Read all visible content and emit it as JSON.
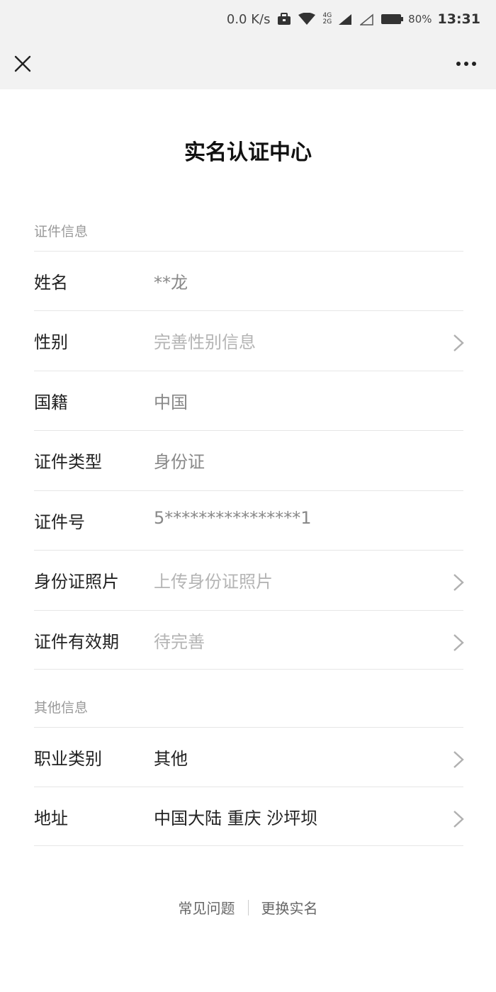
{
  "status_bar": {
    "net_speed": "0.0 K/s",
    "network_type_top": "4G",
    "network_type_bottom": "2G",
    "battery_pct": "80%",
    "time": "13:31"
  },
  "nav": {
    "close_icon": "close-icon",
    "more_icon": "more-icon"
  },
  "page": {
    "title": "实名认证中心"
  },
  "sections": {
    "id_info": {
      "label": "证件信息",
      "rows": [
        {
          "label": "姓名",
          "value": "**龙"
        },
        {
          "label": "性别",
          "value": "完善性别信息"
        },
        {
          "label": "国籍",
          "value": "中国"
        },
        {
          "label": "证件类型",
          "value": "身份证"
        },
        {
          "label": "证件号",
          "value": "5****************1"
        },
        {
          "label": "身份证照片",
          "value": "上传身份证照片"
        },
        {
          "label": "证件有效期",
          "value": "待完善"
        }
      ]
    },
    "other_info": {
      "label": "其他信息",
      "rows": [
        {
          "label": "职业类别",
          "value": "其他"
        },
        {
          "label": "地址",
          "value": "中国大陆 重庆 沙坪坝"
        }
      ]
    }
  },
  "footer": {
    "faq": "常见问题",
    "change_name": "更换实名"
  },
  "colors": {
    "bar_bg": "#f2f2f2",
    "text_primary": "#222222",
    "text_value": "#888888",
    "text_placeholder": "#b4b4b4",
    "divider": "#e6e6e6"
  }
}
